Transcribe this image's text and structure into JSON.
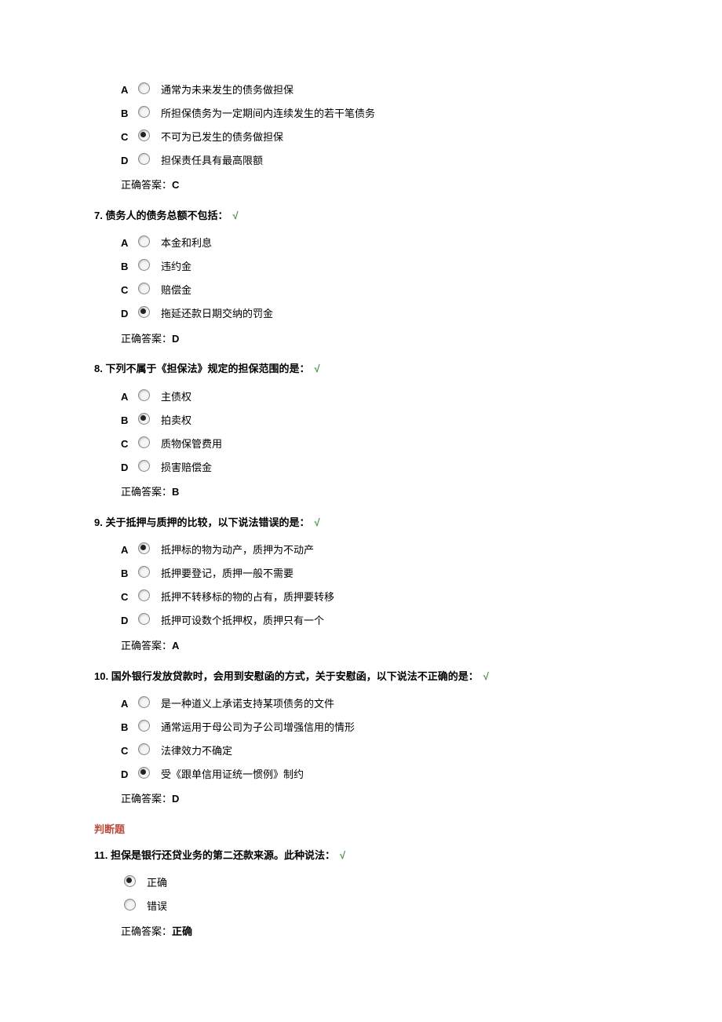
{
  "labels": {
    "answer_prefix": "正确答案：",
    "checkmark": "√"
  },
  "section_tf": "判断题",
  "questions": [
    {
      "num": "",
      "stem": "",
      "show_check": false,
      "options": [
        {
          "letter": "A",
          "selected": false,
          "text": "通常为未来发生的债务做担保"
        },
        {
          "letter": "B",
          "selected": false,
          "text": "所担保债务为一定期间内连续发生的若干笔债务"
        },
        {
          "letter": "C",
          "selected": true,
          "text": "不可为已发生的债务做担保"
        },
        {
          "letter": "D",
          "selected": false,
          "text": "担保责任具有最高限额"
        }
      ],
      "answer": "C"
    },
    {
      "num": "7.",
      "stem": "债务人的债务总额不包括：",
      "show_check": true,
      "options": [
        {
          "letter": "A",
          "selected": false,
          "text": "本金和利息"
        },
        {
          "letter": "B",
          "selected": false,
          "text": "违约金"
        },
        {
          "letter": "C",
          "selected": false,
          "text": "赔偿金"
        },
        {
          "letter": "D",
          "selected": true,
          "text": "拖延还款日期交纳的罚金"
        }
      ],
      "answer": "D"
    },
    {
      "num": "8.",
      "stem": "下列不属于《担保法》规定的担保范围的是：",
      "show_check": true,
      "options": [
        {
          "letter": "A",
          "selected": false,
          "text": "主债权"
        },
        {
          "letter": "B",
          "selected": true,
          "text": "拍卖权"
        },
        {
          "letter": "C",
          "selected": false,
          "text": "质物保管费用"
        },
        {
          "letter": "D",
          "selected": false,
          "text": "损害赔偿金"
        }
      ],
      "answer": "B"
    },
    {
      "num": "9.",
      "stem": "关于抵押与质押的比较，以下说法错误的是：",
      "show_check": true,
      "options": [
        {
          "letter": "A",
          "selected": true,
          "text": "抵押标的物为动产，质押为不动产"
        },
        {
          "letter": "B",
          "selected": false,
          "text": "抵押要登记，质押一般不需要"
        },
        {
          "letter": "C",
          "selected": false,
          "text": "抵押不转移标的物的占有，质押要转移"
        },
        {
          "letter": "D",
          "selected": false,
          "text": "抵押可设数个抵押权，质押只有一个"
        }
      ],
      "answer": "A"
    },
    {
      "num": "10.",
      "stem": "国外银行发放贷款时，会用到安慰函的方式，关于安慰函，以下说法不正确的是：",
      "show_check": true,
      "options": [
        {
          "letter": "A",
          "selected": false,
          "text": "是一种道义上承诺支持某项债务的文件"
        },
        {
          "letter": "B",
          "selected": false,
          "text": "通常运用于母公司为子公司增强信用的情形"
        },
        {
          "letter": "C",
          "selected": false,
          "text": "法律效力不确定"
        },
        {
          "letter": "D",
          "selected": true,
          "text": "受《跟单信用证统一惯例》制约"
        }
      ],
      "answer": "D"
    }
  ],
  "tf_question": {
    "num": "11.",
    "stem": "担保是银行还贷业务的第二还款来源。此种说法：",
    "show_check": true,
    "options": [
      {
        "selected": true,
        "text": "正确"
      },
      {
        "selected": false,
        "text": "错误"
      }
    ],
    "answer": "正确"
  }
}
